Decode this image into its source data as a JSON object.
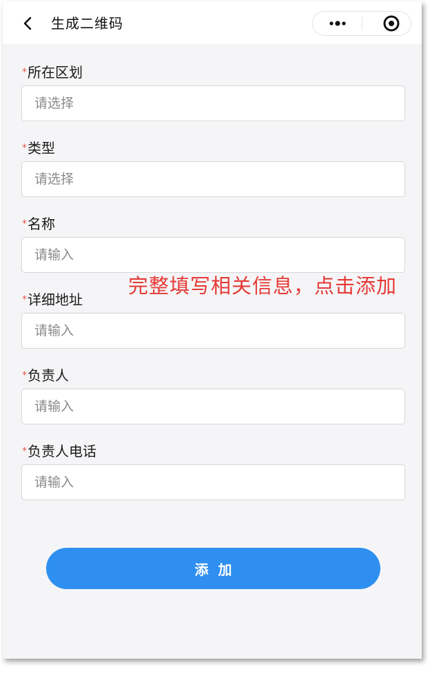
{
  "navbar": {
    "title": "生成二维码",
    "back_icon": "chevron-left-icon",
    "more_icon": "more-dots-icon",
    "close_icon": "target-circle-icon"
  },
  "form": {
    "required_mark": "*",
    "fields": [
      {
        "label": "所在区划",
        "placeholder": "请选择",
        "value": ""
      },
      {
        "label": "类型",
        "placeholder": "请选择",
        "value": ""
      },
      {
        "label": "名称",
        "placeholder": "请输入",
        "value": ""
      },
      {
        "label": "详细地址",
        "placeholder": "请输入",
        "value": ""
      },
      {
        "label": "负责人",
        "placeholder": "请输入",
        "value": ""
      },
      {
        "label": "负责人电话",
        "placeholder": "请输入",
        "value": ""
      }
    ],
    "submit_label": "添加"
  },
  "annotation": {
    "text": "完整填写相关信息，点击添加",
    "color": "#e53935"
  },
  "colors": {
    "primary": "#2e8ff0",
    "required": "#e8574b"
  }
}
